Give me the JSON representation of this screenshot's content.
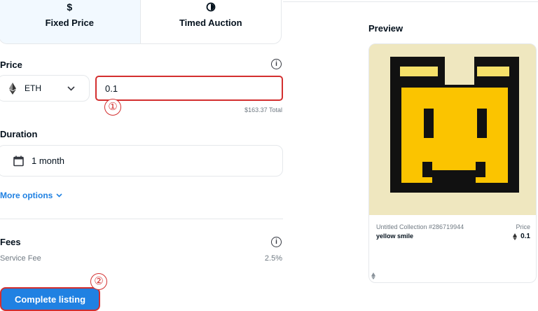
{
  "listing_type": {
    "tabs": [
      {
        "label": "Fixed Price",
        "icon": "dollar-icon",
        "glyph": "$",
        "active": true
      },
      {
        "label": "Timed Auction",
        "icon": "clock-half-icon",
        "active": false
      }
    ]
  },
  "price": {
    "label": "Price",
    "currency": {
      "symbol": "ETH",
      "icon": "ethereum-icon"
    },
    "amount": "0.1",
    "total": "$163.37 Total",
    "marker": "①"
  },
  "duration": {
    "label": "Duration",
    "value": "1 month",
    "icon": "calendar-icon"
  },
  "more_options": {
    "label": "More options"
  },
  "fees": {
    "label": "Fees",
    "service_fee_label": "Service Fee",
    "service_fee_value": "2.5%"
  },
  "complete": {
    "label": "Complete listing",
    "marker": "②"
  },
  "preview": {
    "title": "Preview",
    "collection": "Untitled Collection #286719944",
    "name": "yellow smile",
    "price_label": "Price",
    "price_value": "0.1"
  },
  "colors": {
    "accent": "#2081e2",
    "highlight": "#d32f2f",
    "nft_yellow": "#fbc400",
    "nft_light_yellow": "#f5e06a",
    "nft_background": "#efe7bf"
  }
}
